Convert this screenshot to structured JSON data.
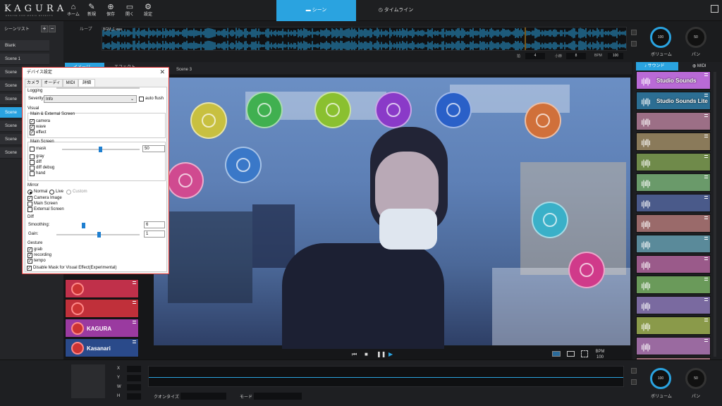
{
  "app": {
    "logo": "KAGURA",
    "logo_sub": "ENGINE FOR MUSIC EFFECTS"
  },
  "toolbar": {
    "home": "ホーム",
    "new": "新規",
    "save": "保存",
    "open": "開く",
    "settings": "設定"
  },
  "main_tabs": {
    "scene": "シーン",
    "timeline": "タイムライン"
  },
  "scene_list": {
    "title": "シーンリスト",
    "add": "+",
    "remove": "−",
    "items": [
      "Blank",
      "Scene 1",
      "Scene",
      "Scene",
      "Scene",
      "Scene",
      "Scene",
      "Scene",
      "Scene"
    ],
    "selected_index": 5
  },
  "loop": {
    "label": "ループ",
    "file": "BGM_1.wav",
    "beat_label": "拍",
    "beat": "4",
    "measure_label": "小節",
    "measure": "8",
    "bpm_label": "BPM",
    "bpm": "100"
  },
  "knobs": {
    "volume_label": "ボリューム",
    "volume": "100",
    "pan_label": "パン",
    "pan": "50"
  },
  "sub_tabs": {
    "image": "イメージ",
    "effect": "エフェクト",
    "scene_name": "Scene 3"
  },
  "sound_tabs": {
    "sound": "サウンド",
    "midi": "MIDI"
  },
  "sounds": [
    {
      "name": "Studio Sounds",
      "color": "#b96ad6"
    },
    {
      "name": "Studio Sounds Lite",
      "color": "#2c6e93"
    },
    {
      "name": "",
      "color": "#9c6f86"
    },
    {
      "name": "",
      "color": "#8a7a5a"
    },
    {
      "name": "",
      "color": "#6f8a4a"
    },
    {
      "name": "",
      "color": "#6a9a6a"
    },
    {
      "name": "",
      "color": "#4a5a8a"
    },
    {
      "name": "",
      "color": "#9a6a6a"
    },
    {
      "name": "",
      "color": "#5a8a9a"
    },
    {
      "name": "",
      "color": "#9a5a8a"
    },
    {
      "name": "",
      "color": "#6a9a5a"
    },
    {
      "name": "",
      "color": "#7a6aa0"
    },
    {
      "name": "",
      "color": "#8a9a4a"
    },
    {
      "name": "",
      "color": "#9a6aa0"
    },
    {
      "name": "",
      "color": "#a0707a"
    }
  ],
  "left_thumbs": [
    {
      "name": "",
      "color": "#c0304a"
    },
    {
      "name": "",
      "color": "#c0303a"
    },
    {
      "name": "KAGURA",
      "color": "#9a3aa0"
    },
    {
      "name": "Kasanari",
      "color": "#2a4a8a"
    }
  ],
  "transport": {
    "bpm_label": "BPM",
    "bpm": "100"
  },
  "bottom": {
    "x": "X",
    "y": "Y",
    "w": "W",
    "h": "H",
    "quantize": "クオンタイズ",
    "mode": "モード",
    "volume_label": "ボリューム",
    "volume": "100",
    "pan_label": "パン",
    "pan": "50"
  },
  "dialog": {
    "title": "デバイス設定",
    "close": "✕",
    "tabs": [
      "カメラ",
      "オーディオ",
      "MIDI",
      "詳細"
    ],
    "logging": "Logging",
    "severity_label": "Severity:",
    "severity_value": "Info",
    "auto_flush": "auto flush",
    "visual": "Visual",
    "main_external": "Main & External Screen",
    "camera": "camera",
    "wave": "wave",
    "effect": "effect",
    "main_screen": "Main Screen",
    "mask": "mask",
    "mask_value": "50",
    "gray": "gray",
    "diff": "diff",
    "diff_debug": "diff debug",
    "hand": "hand",
    "mirror": "Mirror",
    "normal": "Normal",
    "live": "Live",
    "custom": "Custom",
    "camera_image": "Camera Image",
    "main_screen2": "Main Screen",
    "external_screen": "External Screen",
    "diff_group": "Diff",
    "smoothing_label": "Smoothing:",
    "smoothing": "6",
    "gain_label": "Gain:",
    "gain": "1",
    "gesture": "Gesture",
    "grab": "grab",
    "recording": "recording",
    "tempo": "tempo",
    "disable_mask": "Disable Mask for Visual Effect(Experimental)"
  }
}
